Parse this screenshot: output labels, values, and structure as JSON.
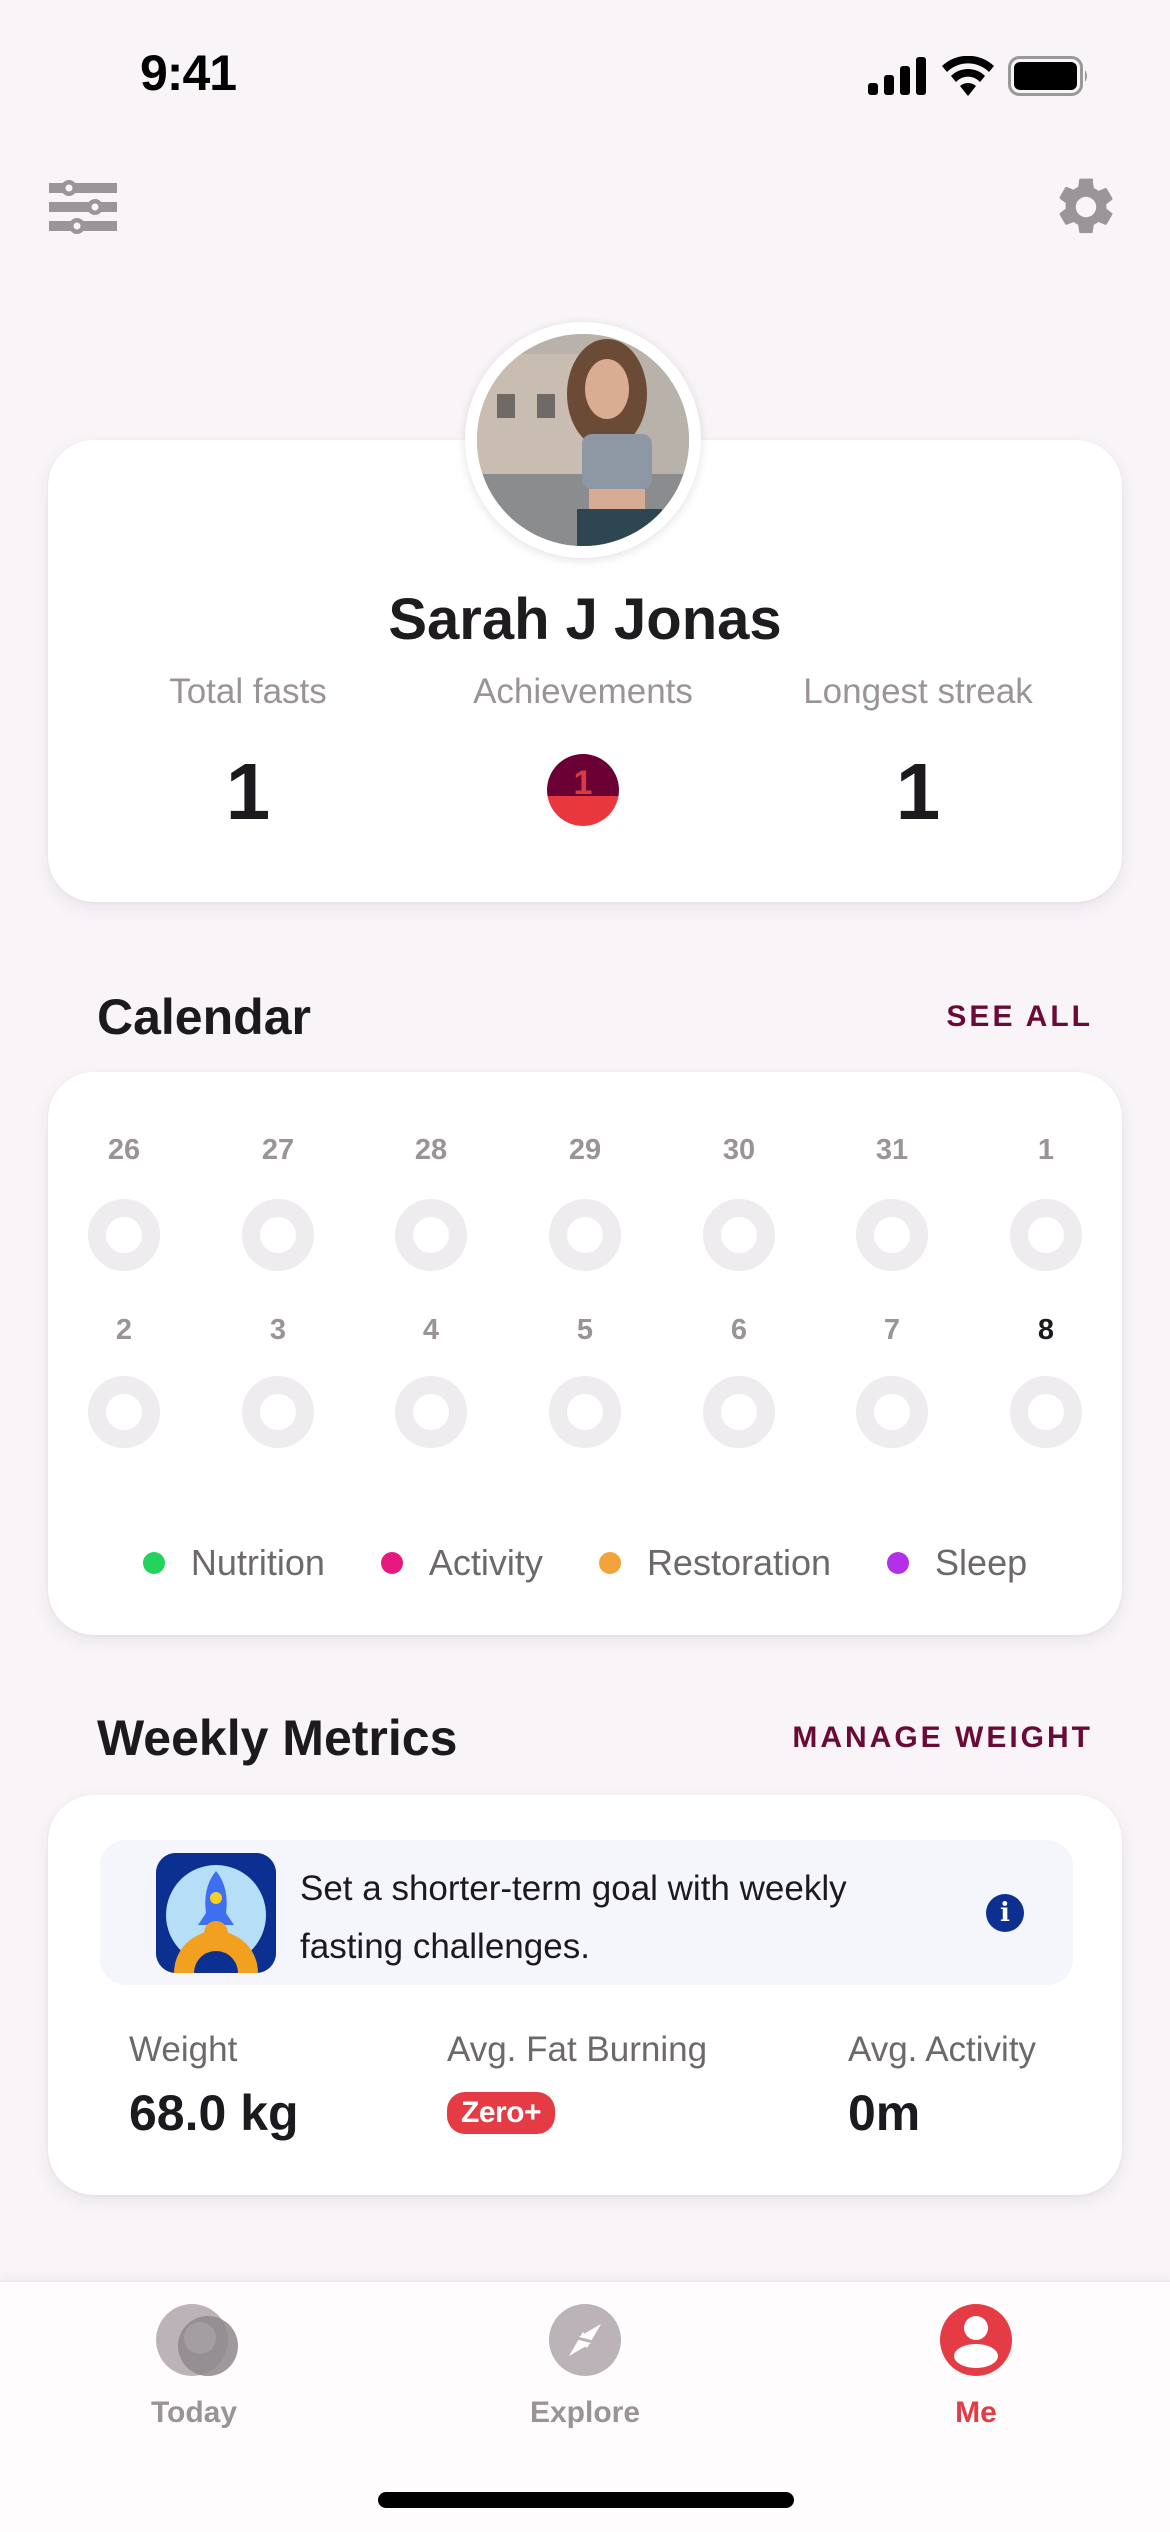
{
  "status_bar": {
    "time": "9:41"
  },
  "header": {
    "filter_icon": "sliders-icon",
    "settings_icon": "gear-icon"
  },
  "profile": {
    "name": "Sarah J Jonas",
    "stats": [
      {
        "label": "Total fasts",
        "value": "1"
      },
      {
        "label": "Achievements",
        "value": "1"
      },
      {
        "label": "Longest streak",
        "value": "1"
      }
    ],
    "achievement_colors": {
      "top": "#6b0035",
      "bottom": "#e8383d"
    }
  },
  "calendar": {
    "title": "Calendar",
    "see_all": "SEE ALL",
    "weeks": [
      [
        "26",
        "27",
        "28",
        "29",
        "30",
        "31",
        "1"
      ],
      [
        "2",
        "3",
        "4",
        "5",
        "6",
        "7",
        "8"
      ]
    ],
    "today": "8",
    "legend": [
      {
        "label": "Nutrition",
        "color": "#22d35c"
      },
      {
        "label": "Activity",
        "color": "#e5197f"
      },
      {
        "label": "Restoration",
        "color": "#f2a43a"
      },
      {
        "label": "Sleep",
        "color": "#b330e8"
      }
    ]
  },
  "weekly_metrics": {
    "title": "Weekly Metrics",
    "manage_link": "MANAGE WEIGHT",
    "banner_text": "Set a shorter-term goal with weekly fasting challenges.",
    "metrics": [
      {
        "label": "Weight",
        "value": "68.0 kg"
      },
      {
        "label": "Avg. Fat Burning",
        "badge": "Zero+"
      },
      {
        "label": "Avg. Activity",
        "value": "0m"
      }
    ]
  },
  "bottom_nav": {
    "items": [
      {
        "label": "Today",
        "icon": "today-icon",
        "active": false
      },
      {
        "label": "Explore",
        "icon": "compass-icon",
        "active": false
      },
      {
        "label": "Me",
        "icon": "profile-icon",
        "active": true
      }
    ]
  },
  "colors": {
    "accent": "#e43b44",
    "brand_dark": "#6a0a36",
    "muted": "#9a9398"
  }
}
